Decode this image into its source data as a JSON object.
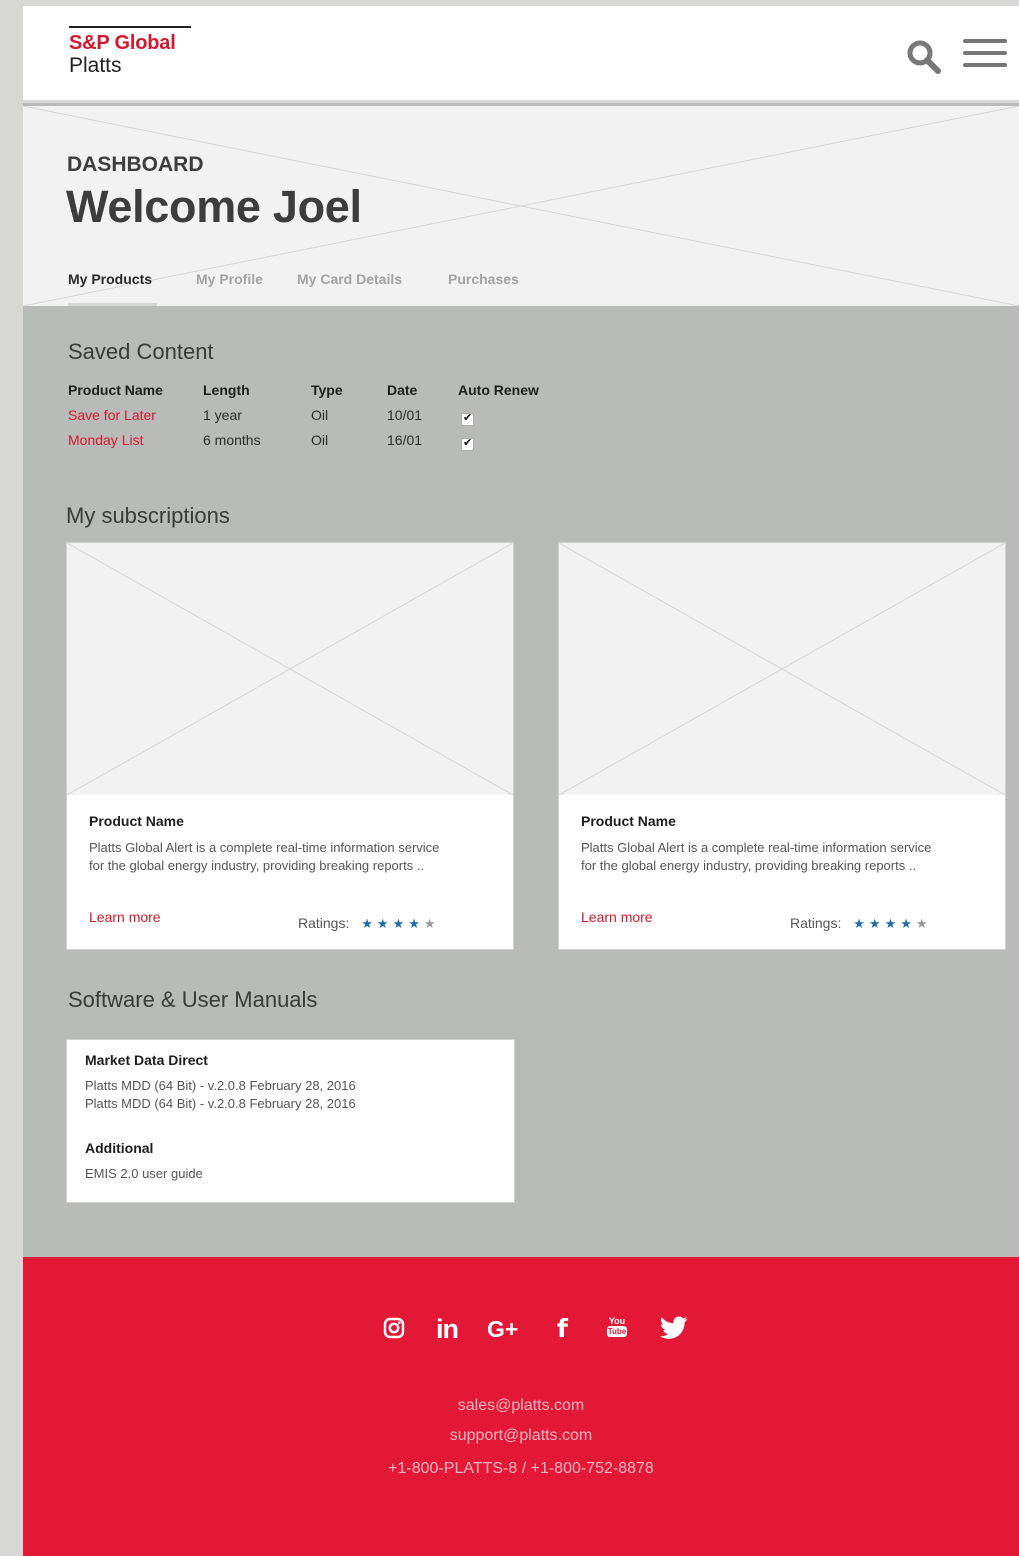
{
  "brand": {
    "name": "S&P Global",
    "product": "Platts"
  },
  "hero": {
    "eyebrow": "DASHBOARD",
    "title": "Welcome Joel",
    "tabs": [
      {
        "label": "My Products",
        "active": true
      },
      {
        "label": "My Profile",
        "active": false
      },
      {
        "label": "My Card Details",
        "active": false
      },
      {
        "label": "Purchases",
        "active": false
      }
    ]
  },
  "saved_content": {
    "title": "Saved Content",
    "headers": [
      "Product Name",
      "Length",
      "Type",
      "Date",
      "Auto Renew"
    ],
    "rows": [
      {
        "name": "Save for Later",
        "length": "1 year",
        "type": "Oil",
        "date": "10/01",
        "auto_renew": true
      },
      {
        "name": "Monday List",
        "length": "6 months",
        "type": "Oil",
        "date": "16/01",
        "auto_renew": true
      }
    ]
  },
  "subscriptions": {
    "title": "My subscriptions",
    "cards": [
      {
        "name": "Product Name",
        "description": "Platts Global Alert is a complete real-time information service for the global energy industry, providing breaking reports ..",
        "link": "Learn more",
        "ratings_label": "Ratings:",
        "rating": 4,
        "rating_max": 5
      },
      {
        "name": "Product Name",
        "description": "Platts Global Alert is a complete real-time information service for the global energy industry, providing breaking reports ..",
        "link": "Learn more",
        "ratings_label": "Ratings:",
        "rating": 4,
        "rating_max": 5
      }
    ]
  },
  "manuals": {
    "title": "Software & User Manuals",
    "group1_title": "Market Data Direct",
    "group1_lines": [
      "Platts MDD (64 Bit) - v.2.0.8 February 28, 2016",
      "Platts MDD (64 Bit) - v.2.0.8 February 28, 2016"
    ],
    "group2_title": "Additional",
    "group2_lines": [
      "EMIS 2.0 user guide"
    ]
  },
  "footer": {
    "social_icons": [
      "instagram-icon",
      "linkedin-icon",
      "google-plus-icon",
      "facebook-icon",
      "youtube-icon",
      "twitter-icon"
    ],
    "social_glyphs": {
      "linkedin": "in",
      "google_plus": "G+",
      "facebook": "f",
      "youtube_top": "You",
      "youtube_bottom": "Tube"
    },
    "email_sales": "sales@platts.com",
    "email_support": "support@platts.com",
    "phone": "+1-800-PLATTS-8 / +1-800-752-8878"
  },
  "colors": {
    "brand_red": "#e31837",
    "star_blue": "#1c6fa5",
    "link_red": "#d6172e"
  }
}
